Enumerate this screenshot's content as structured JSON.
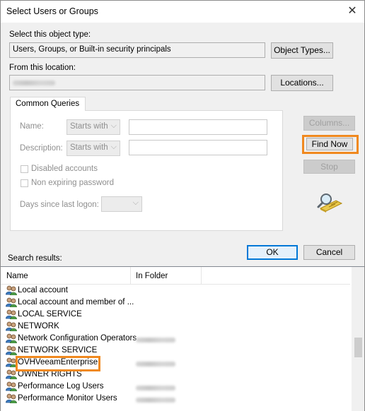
{
  "window": {
    "title": "Select Users or Groups",
    "close_glyph": "✕"
  },
  "object_type": {
    "label": "Select this object type:",
    "value": "Users, Groups, or Built-in security principals",
    "button": "Object Types..."
  },
  "location": {
    "label": "From this location:",
    "button": "Locations..."
  },
  "queries": {
    "tab": "Common Queries",
    "name_label": "Name:",
    "description_label": "Description:",
    "starts_with": "Starts with",
    "disabled_accounts": "Disabled accounts",
    "non_expiring_password": "Non expiring password",
    "days_since_last_logon": "Days since last logon:"
  },
  "buttons": {
    "columns": "Columns...",
    "find_now": "Find Now",
    "stop": "Stop",
    "ok": "OK",
    "cancel": "Cancel"
  },
  "results": {
    "label": "Search results:",
    "columns": [
      "Name",
      "In Folder"
    ],
    "rows": [
      {
        "name": "Local account",
        "has_folder": false
      },
      {
        "name": "Local account and member of ...",
        "has_folder": false
      },
      {
        "name": "LOCAL SERVICE",
        "has_folder": false
      },
      {
        "name": "NETWORK",
        "has_folder": false
      },
      {
        "name": "Network Configuration Operators",
        "has_folder": true
      },
      {
        "name": "NETWORK SERVICE",
        "has_folder": false
      },
      {
        "name": "OVHVeeamEnterprise",
        "has_folder": true,
        "highlighted": true
      },
      {
        "name": "OWNER RIGHTS",
        "has_folder": false
      },
      {
        "name": "Performance Log Users",
        "has_folder": true
      },
      {
        "name": "Performance Monitor Users",
        "has_folder": true
      }
    ]
  },
  "icons": {
    "close": "close-icon",
    "chevron": "chevron-down-icon",
    "search": "search-folder-icon",
    "group": "group-icon"
  },
  "colors": {
    "highlight": "#f0891f",
    "default_button_border": "#0078d7"
  }
}
